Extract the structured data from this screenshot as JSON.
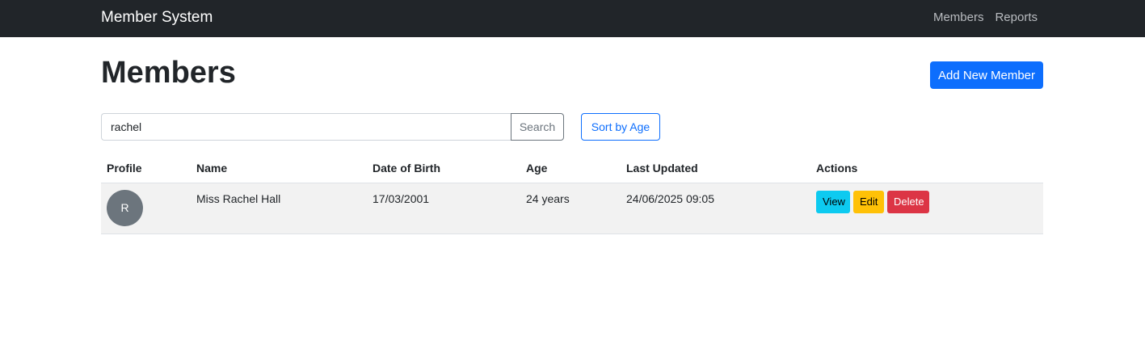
{
  "navbar": {
    "brand": "Member System",
    "links": [
      "Members",
      "Reports"
    ]
  },
  "page": {
    "title": "Members",
    "add_button": "Add New Member"
  },
  "search": {
    "value": "rachel",
    "button": "Search",
    "sort_button": "Sort by Age"
  },
  "table": {
    "headers": [
      "Profile",
      "Name",
      "Date of Birth",
      "Age",
      "Last Updated",
      "Actions"
    ],
    "rows": [
      {
        "avatar": "R",
        "name": "Miss Rachel Hall",
        "dob": "17/03/2001",
        "age": "24 years",
        "updated": "24/06/2025 09:05",
        "actions": [
          "View",
          "Edit",
          "Delete"
        ]
      }
    ]
  },
  "colors": {
    "navbar": "#212529",
    "primary": "#0d6efd",
    "info": "#0dcaf0",
    "warning": "#ffc107",
    "danger": "#dc3545",
    "avatar": "#6c757d"
  }
}
